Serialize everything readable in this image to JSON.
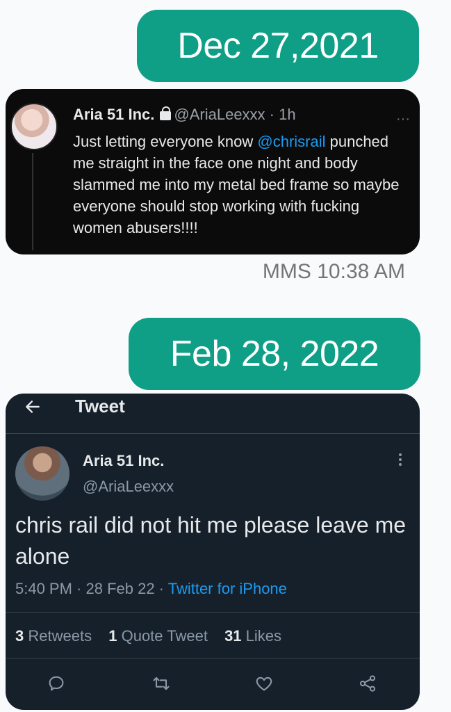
{
  "messages": [
    {
      "date": "Dec 27,2021"
    },
    {
      "date": "Feb 28, 2022"
    }
  ],
  "tweet1": {
    "name": "Aria 51 Inc.",
    "handle": "@AriaLeexxx",
    "time": " · 1h",
    "more": "···",
    "text_before": "Just letting everyone know ",
    "mention": "@chrisrail",
    "text_after": " punched me straight in the face one night and body slammed me into my metal bed frame so maybe everyone should stop working with fucking women abusers!!!!",
    "meta": "MMS 10:38 AM"
  },
  "tweet2": {
    "topbar_title": "Tweet",
    "name": "Aria 51 Inc.",
    "handle": "@AriaLeexxx",
    "text": "chris rail did not hit me please leave me alone",
    "time_date": "5:40 PM · 28 Feb 22 · ",
    "source": "Twitter for iPhone",
    "stats": {
      "retweets_count": "3",
      "retweets_label": "Retweets",
      "quotes_count": "1",
      "quotes_label": "Quote Tweet",
      "likes_count": "31",
      "likes_label": "Likes"
    },
    "actions": [
      "reply-icon",
      "retweet-icon",
      "like-icon",
      "share-icon"
    ]
  },
  "colors": {
    "bubble": "#0f9e86",
    "tweet1_bg": "#0b0b0c",
    "tweet2_bg": "#15202b",
    "link": "#1d9bf0"
  }
}
